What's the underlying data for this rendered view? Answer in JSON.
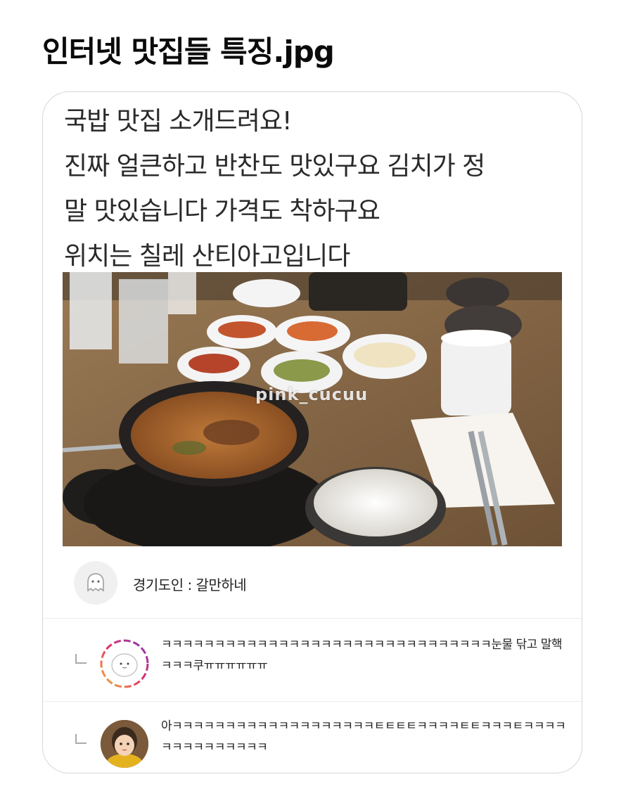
{
  "page": {
    "title": "인터넷 맛집들 특징.jpg"
  },
  "post": {
    "lines": [
      "국밥 맛집 소개드려요!",
      "진짜 얼큰하고 반찬도 맛있구요 김치가 정",
      "말 맛있습니다 가격도 착하구요",
      "위치는 칠레 산티아고입니다"
    ],
    "image": {
      "watermark": "pink_cucuu"
    }
  },
  "comments": [
    {
      "text": "경기도인 : 갈만하네",
      "avatar": "ghost-icon"
    }
  ],
  "replies": [
    {
      "text": "ㅋㅋㅋㅋㅋㅋㅋㅋㅋㅋㅋㅋㅋㅋㅋㅋㅋㅋㅋㅋㅋㅋㅋㅋㅋㅋㅋㅋㅋㅋㅋ눈물 닦고 말핵ㅋㅋㅋ쿠ㅠㅠㅠㅠㅠㅠ",
      "avatar": "white-character-avatar"
    },
    {
      "text": "아ㅋㅋㅋㅋㅋㅋㅋㅋㅋㅋㅋㅋㅋㅋㅋㅋㅋㅋㅋㅌㅌㅌㅌㅋㅋㅋㅋㅌㅌㅋㅋㅋㅌㅋㅋㅋㅋㅋㅋㅋㅋㅋㅋㅋㅋㅋㅋ",
      "avatar": "child-photo-avatar"
    }
  ],
  "colors": {
    "card_border": "#d7d7d7",
    "ring_gradient": [
      "#f7b733",
      "#e1306c",
      "#833ab4"
    ]
  }
}
